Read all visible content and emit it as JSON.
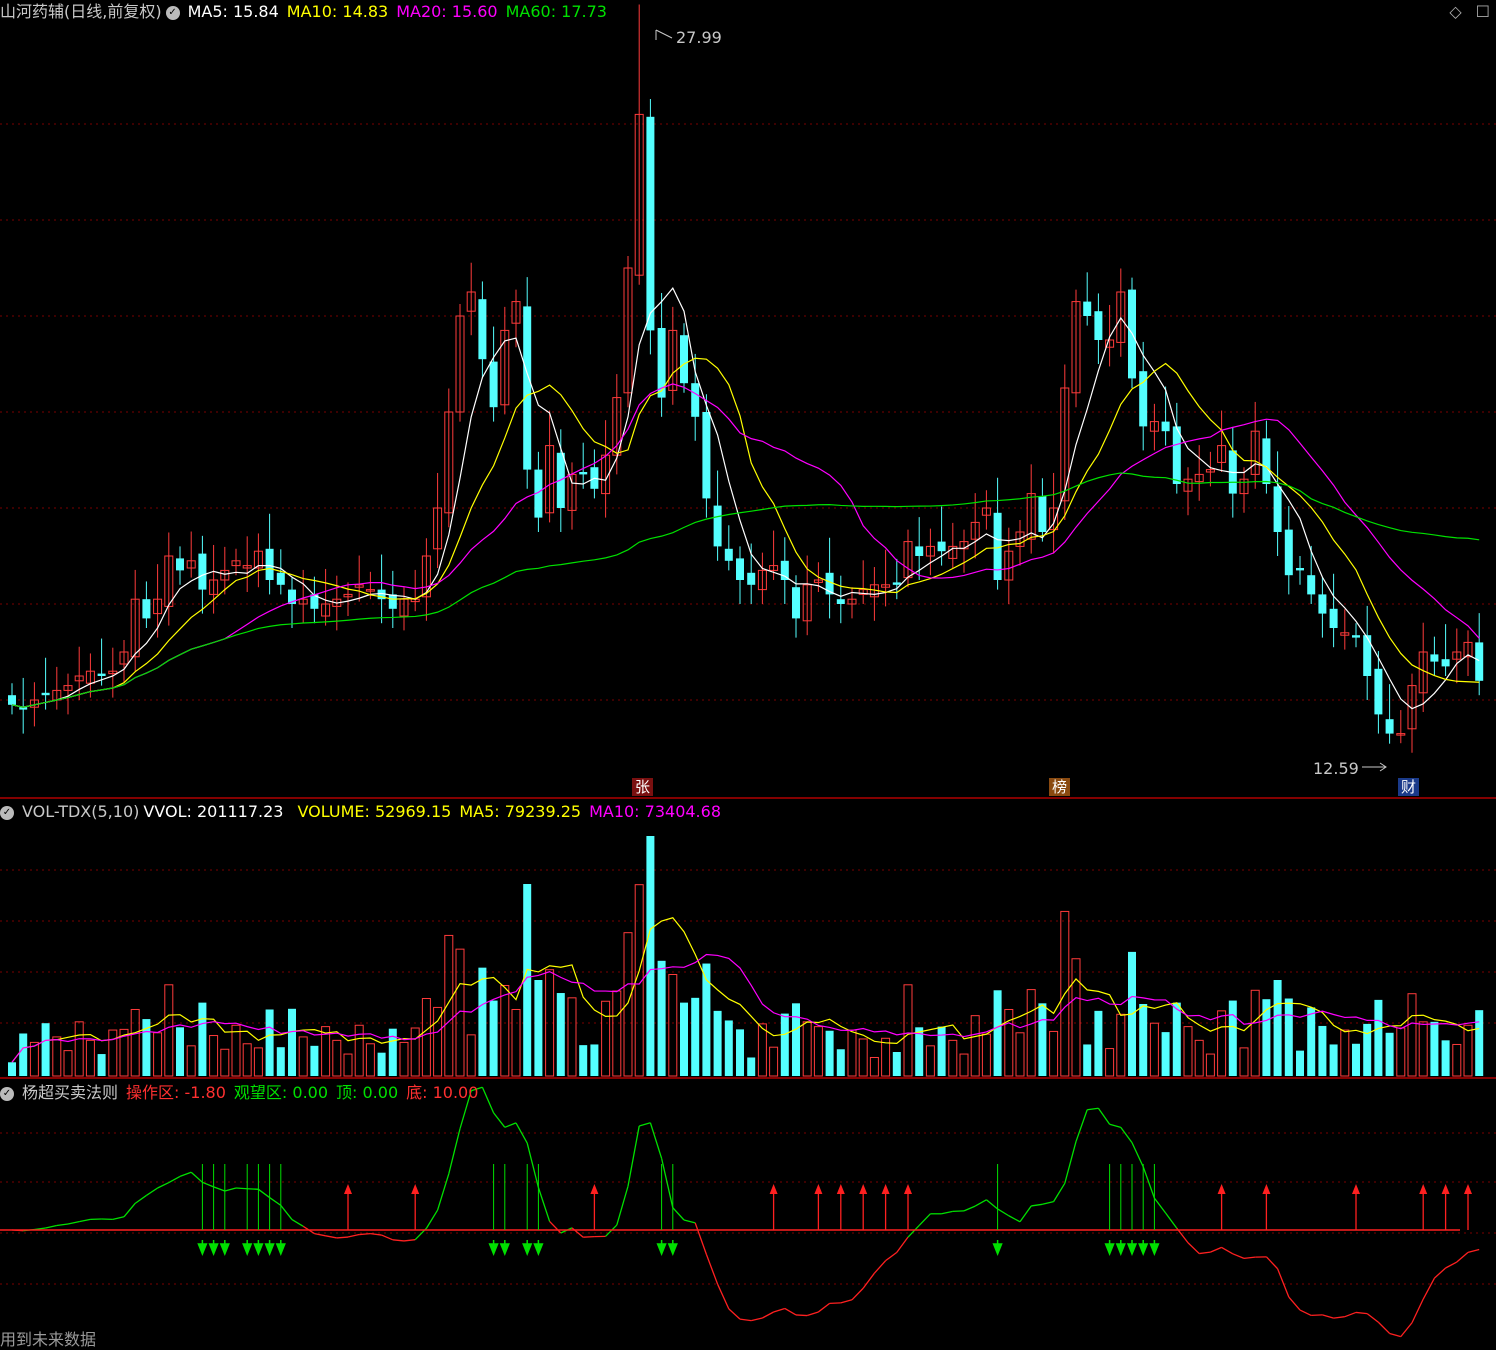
{
  "main_header": {
    "stock": "山河药辅(日线,前复权)",
    "ma5": "MA5: 15.84",
    "ma10": "MA10: 14.83",
    "ma20": "MA20: 15.60",
    "ma60": "MA60: 17.73"
  },
  "vol_header": {
    "name": "VOL-TDX(5,10)",
    "vvol": "VVOL: 201117.23",
    "volume": "VOLUME: 52969.15",
    "ma5": "MA5: 79239.25",
    "ma10": "MA10: 73404.68"
  },
  "ind_header": {
    "name": "杨超买卖法则",
    "op": "操作区: -1.80",
    "watch": "观望区: 0.00",
    "top": "顶: 0.00",
    "bottom": "底: 10.00"
  },
  "annotations": {
    "high": "27.99",
    "low": "12.59",
    "tag_zhang": "张",
    "tag_bang": "榜",
    "tag_cai": "财"
  },
  "footer": "用到未来数据",
  "colors": {
    "up": "#ff3b3b",
    "down": "#54ffff",
    "ma5": "#ffffff",
    "ma10": "#ffff00",
    "ma20": "#ff00ff",
    "ma60": "#00e000",
    "grid": "#7a0000",
    "separator": "#b00000"
  },
  "chart_data": {
    "type": "candlestick",
    "price_high": 27.99,
    "price_low": 12.59,
    "closes": [
      13.4,
      13.3,
      13.5,
      13.6,
      13.7,
      13.8,
      14.0,
      14.1,
      14.0,
      14.1,
      14.5,
      15.6,
      15.2,
      15.6,
      16.5,
      16.2,
      16.4,
      15.8,
      16.0,
      16.2,
      16.4,
      16.3,
      16.6,
      16.0,
      15.9,
      15.5,
      15.6,
      15.4,
      15.5,
      15.6,
      15.7,
      15.9,
      15.8,
      15.6,
      15.4,
      15.6,
      15.6,
      16.5,
      17.5,
      19.5,
      21.5,
      22.0,
      20.6,
      19.6,
      21.2,
      21.8,
      18.3,
      17.3,
      18.8,
      17.5,
      18.2,
      18.2,
      17.9,
      18.6,
      19.8,
      22.5,
      25.7,
      21.2,
      19.8,
      21.2,
      20.1,
      19.4,
      17.7,
      16.7,
      16.4,
      16.0,
      15.9,
      16.2,
      16.3,
      16.0,
      15.2,
      15.9,
      16.0,
      15.7,
      15.5,
      15.6,
      15.8,
      15.9,
      15.9,
      15.9,
      16.8,
      16.5,
      16.7,
      16.6,
      16.7,
      16.8,
      17.2,
      17.5,
      16.0,
      16.6,
      17.0,
      17.8,
      17.0,
      17.5,
      20.0,
      21.8,
      21.5,
      21.0,
      21.0,
      22.0,
      20.2,
      19.2,
      19.3,
      19.1,
      18.0,
      18.1,
      18.2,
      18.3,
      18.8,
      17.8,
      18.1,
      19.1,
      18.0,
      17.0,
      16.1,
      16.2,
      15.7,
      15.3,
      15.0,
      14.9,
      14.8,
      14.0,
      13.2,
      12.8,
      12.8,
      13.8,
      14.5,
      14.3,
      14.2,
      14.5,
      14.7,
      13.9
    ]
  }
}
